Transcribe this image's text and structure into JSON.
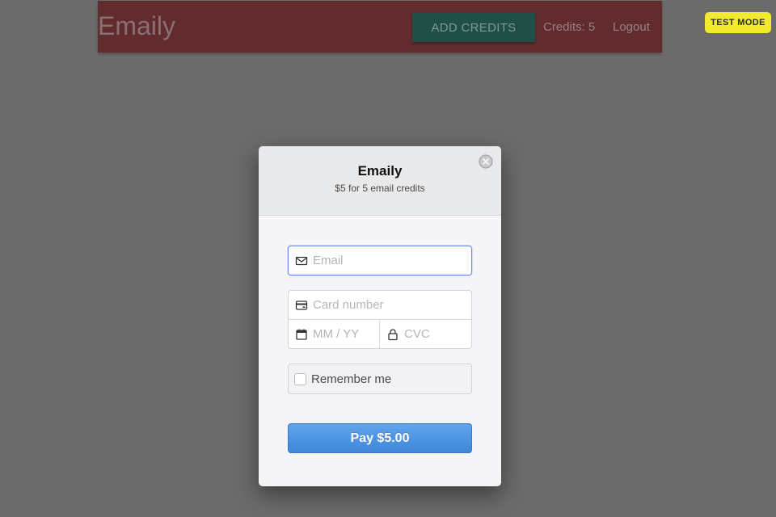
{
  "navbar": {
    "brand": "Emaily",
    "add_credits_label": "ADD CREDITS",
    "credits_text": "Credits: 5",
    "logout_label": "Logout"
  },
  "badge": {
    "test_mode": "TEST MODE"
  },
  "checkout": {
    "title": "Emaily",
    "subtitle": "$5 for 5 email credits",
    "email_placeholder": "Email",
    "card_number_placeholder": "Card number",
    "expiry_placeholder": "MM / YY",
    "cvc_placeholder": "CVC",
    "remember_label": "Remember me",
    "pay_label": "Pay $5.00",
    "icons": {
      "close": "close-icon",
      "email": "envelope-icon",
      "card": "credit-card-icon",
      "expiry": "calendar-icon",
      "cvc": "lock-icon"
    }
  },
  "colors": {
    "overlay": "#6b6b6b",
    "navbar": "#622c2f",
    "add_credits_button": "#1f4f47",
    "test_mode_badge": "#f2ea2f",
    "pay_button": "#4a90e2",
    "focus_ring": "#6d8ee6"
  }
}
